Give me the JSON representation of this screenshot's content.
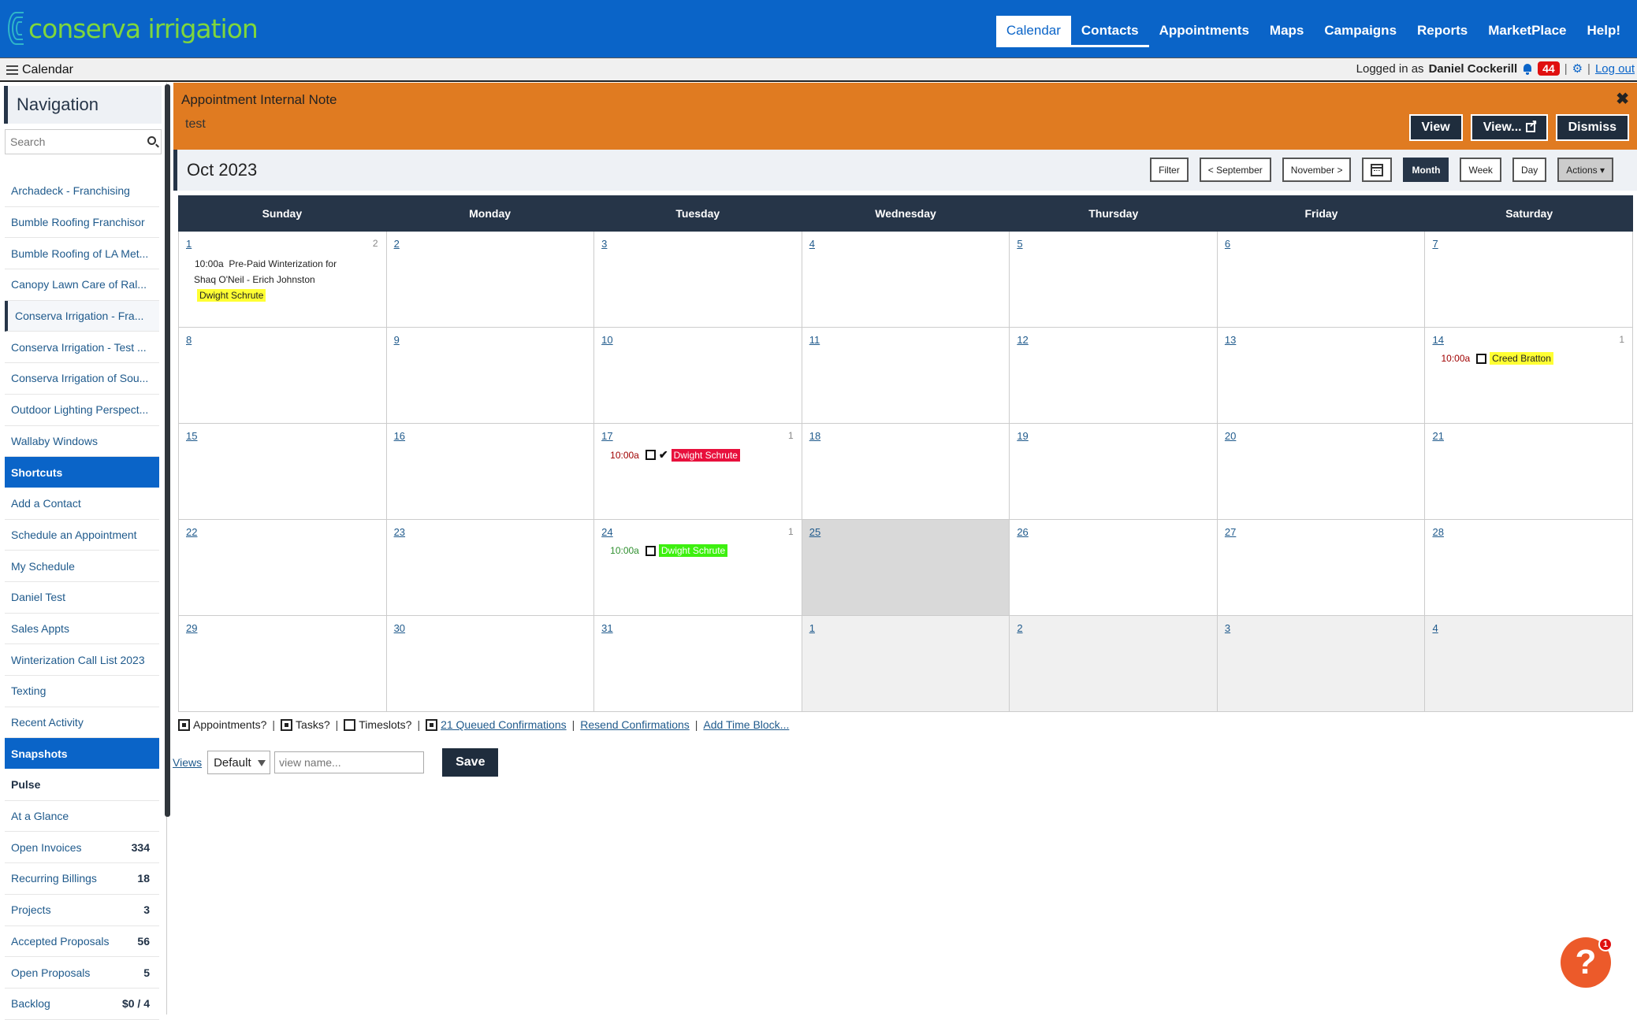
{
  "brand": {
    "logo_text": "conserva irrigation"
  },
  "topnav": [
    "Calendar",
    "Contacts",
    "Appointments",
    "Maps",
    "Campaigns",
    "Reports",
    "MarketPlace",
    "Help!"
  ],
  "subbar": {
    "title": "Calendar",
    "logged_in_prefix": "Logged in as",
    "user_name": "Daniel Cockerill",
    "notification_count": "44",
    "separator": "|",
    "logout": "Log out"
  },
  "sidebar": {
    "heading": "Navigation",
    "search_placeholder": "Search",
    "items": [
      {
        "label": "Archadeck - Franchising"
      },
      {
        "label": "Bumble Roofing Franchisor"
      },
      {
        "label": "Bumble Roofing of LA Met..."
      },
      {
        "label": "Canopy Lawn Care of Ral..."
      },
      {
        "label": "Conserva Irrigation - Fra..."
      },
      {
        "label": "Conserva Irrigation - Test ..."
      },
      {
        "label": "Conserva Irrigation of Sou..."
      },
      {
        "label": "Outdoor Lighting Perspect..."
      },
      {
        "label": "Wallaby Windows"
      },
      {
        "label": "Shortcuts"
      },
      {
        "label": "Add a Contact"
      },
      {
        "label": "Schedule an Appointment"
      },
      {
        "label": "My Schedule"
      },
      {
        "label": "Daniel Test"
      },
      {
        "label": "Sales Appts"
      },
      {
        "label": "Winterization Call List 2023"
      },
      {
        "label": "Texting"
      },
      {
        "label": "Recent Activity"
      },
      {
        "label": "Snapshots"
      },
      {
        "label": "Pulse"
      },
      {
        "label": "At a Glance"
      },
      {
        "label": "Open Invoices",
        "count": "334"
      },
      {
        "label": "Recurring Billings",
        "count": "18"
      },
      {
        "label": "Projects",
        "count": "3"
      },
      {
        "label": "Accepted Proposals",
        "count": "56"
      },
      {
        "label": "Open Proposals",
        "count": "5"
      },
      {
        "label": "Backlog",
        "count": "$0 / 4"
      }
    ]
  },
  "alert": {
    "title": "Appointment Internal Note",
    "body": "test",
    "buttons": [
      "View",
      "View...",
      "Dismiss"
    ],
    "close": "✖"
  },
  "calendar": {
    "title": "Oct 2023",
    "tools": {
      "filter": "Filter",
      "prev": "< September",
      "next": "November >",
      "month": "Month",
      "week": "Week",
      "day": "Day",
      "actions": "Actions ▾"
    },
    "day_names": [
      "Sunday",
      "Monday",
      "Tuesday",
      "Wednesday",
      "Thursday",
      "Friday",
      "Saturday"
    ],
    "weeks": [
      [
        "1",
        "2",
        "3",
        "4",
        "5",
        "6",
        "7"
      ],
      [
        "8",
        "9",
        "10",
        "11",
        "12",
        "13",
        "14"
      ],
      [
        "15",
        "16",
        "17",
        "18",
        "19",
        "20",
        "21"
      ],
      [
        "22",
        "23",
        "24",
        "25",
        "26",
        "27",
        "28"
      ],
      [
        "29",
        "30",
        "31",
        "1",
        "2",
        "3",
        "4"
      ]
    ],
    "counts": {
      "1": "2",
      "14": "1",
      "17": "1",
      "24": "1"
    },
    "events": {
      "oct1": {
        "time": "10:00a",
        "title_line1": "Pre-Paid Winterization for",
        "title_line2": "Shaq O'Neil - Erich Johnston",
        "assignee": "Dwight Schrute"
      },
      "oct14": {
        "time": "10:00a",
        "assignee": "Creed Bratton"
      },
      "oct17": {
        "time": "10:00a",
        "assignee": "Dwight Schrute"
      },
      "oct24": {
        "time": "10:00a",
        "assignee": "Dwight Schrute"
      }
    }
  },
  "legend": {
    "appointments": "Appointments?",
    "tasks": "Tasks?",
    "timeslots": "Timeslots?",
    "queued": "21 Queued Confirmations",
    "resend": "Resend Confirmations",
    "add_time_block": "Add Time Block...",
    "pipe": "|"
  },
  "views": {
    "link": "Views",
    "selected": "Default",
    "input_placeholder": "view name...",
    "save": "Save"
  },
  "help": {
    "glyph": "?",
    "badge": "1"
  },
  "colors": {
    "brand_blue": "#0a64c8",
    "navy": "#263548",
    "alert_orange": "#e07b21",
    "chip_yellow": "#ffff33",
    "chip_red": "#e8103c",
    "chip_green": "#3df00f",
    "time_red": "#a00000",
    "time_green": "#2f8f2f"
  }
}
